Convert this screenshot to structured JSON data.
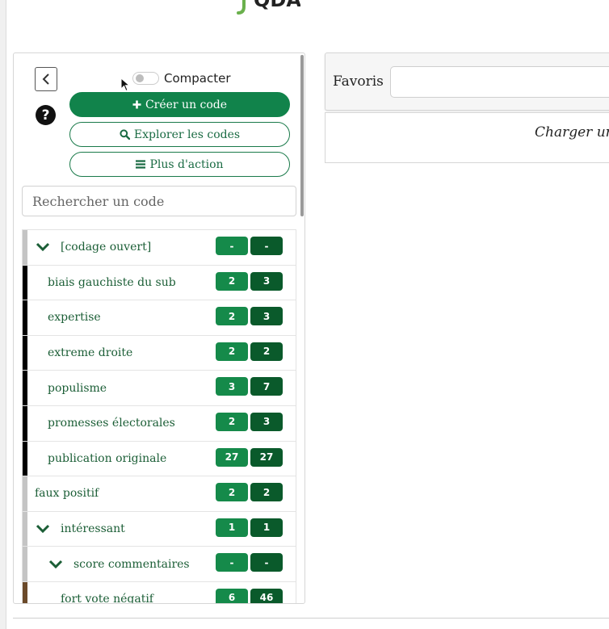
{
  "header": {
    "logo_text": "QDA"
  },
  "sidebar": {
    "compact_toggle_label": "Compacter",
    "create_code_label": "Créer un code",
    "explore_codes_label": "Explorer les codes",
    "more_actions_label": "Plus d'action",
    "search_placeholder": "Rechercher un code",
    "codes": [
      {
        "label": "[codage ouvert]",
        "count_a": "-",
        "count_b": "-",
        "expanded": true
      },
      {
        "label": "biais gauchiste du sub",
        "count_a": "2",
        "count_b": "3"
      },
      {
        "label": "expertise",
        "count_a": "2",
        "count_b": "3"
      },
      {
        "label": "extreme droite",
        "count_a": "2",
        "count_b": "2"
      },
      {
        "label": "populisme",
        "count_a": "3",
        "count_b": "7"
      },
      {
        "label": "promesses électorales",
        "count_a": "2",
        "count_b": "3"
      },
      {
        "label": "publication originale",
        "count_a": "27",
        "count_b": "27"
      },
      {
        "label": "faux positif",
        "count_a": "2",
        "count_b": "2"
      },
      {
        "label": "intéressant",
        "count_a": "1",
        "count_b": "1",
        "expanded": true
      },
      {
        "label": "score commentaires",
        "count_a": "-",
        "count_b": "-",
        "expanded": true
      },
      {
        "label": "fort vote négatif",
        "count_a": "6",
        "count_b": "46"
      }
    ],
    "colors": {
      "primary": "#11834b",
      "badge_light": "#158a4a",
      "badge_dark": "#0a5a2b",
      "label_green": "#1b5e36"
    }
  },
  "main": {
    "favorites_label": "Favoris",
    "document_prompt": "Charger un"
  }
}
